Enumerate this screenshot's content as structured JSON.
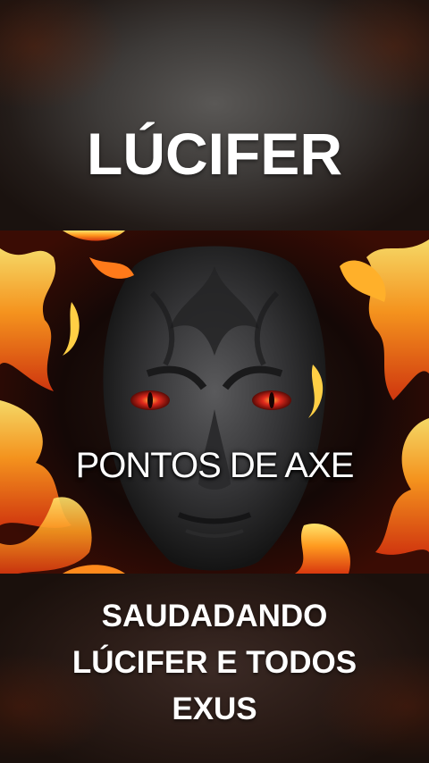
{
  "title": "LÚCIFER",
  "artwork": {
    "caption": "PONTOS DE AXE",
    "subject": "dark-stone-face-with-red-eyes",
    "colors": {
      "flame_outer": "#e8471a",
      "flame_mid": "#ff9a1f",
      "flame_core": "#ffe36b",
      "stone": "#3a3a3c",
      "eye_red": "#e0281c"
    }
  },
  "subtitle": {
    "lines": [
      "SAUDADANDO",
      "LÚCIFER E TODOS",
      "EXUS"
    ]
  }
}
